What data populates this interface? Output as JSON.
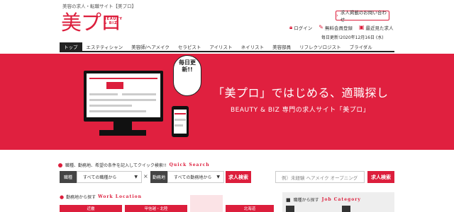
{
  "header": {
    "tagline": "美容の求人・転職サイト【美プロ】",
    "logo_kanji": "美プロ",
    "logo_sub_1": "BEAUTY",
    "logo_sub_2": "& BIZ",
    "inquiry": "求人掲載のお問い合わせ",
    "links": [
      {
        "label": "ログイン",
        "icon": "lock-icon"
      },
      {
        "label": "無料会員登録",
        "icon": "register-icon"
      },
      {
        "label": "最近見た求人",
        "icon": "history-icon"
      }
    ],
    "updated": "毎日更新!2020年12月16日 (水)"
  },
  "nav": [
    "トップ",
    "エステティシャン",
    "美容師/ヘアメイク",
    "セラピスト",
    "アイリスト",
    "ネイリスト",
    "美容部員",
    "リフレクソロジスト",
    "ブライダル"
  ],
  "hero": {
    "bubble": "毎日更新!!",
    "title": "「美プロ」ではじめる、適職探し",
    "subtitle": "BEAUTY & BIZ 専門の求人サイト「美プロ」",
    "color": "#e0203f"
  },
  "quick": {
    "label": "職種、勤務地、希望の条件を記入してクイック検索!!",
    "label_en": "Quick Search",
    "occupation_label": "職種",
    "occupation_value": "すべての職種から",
    "times": "×",
    "location_label": "勤務地",
    "location_value": "すべての勤務地から",
    "search_button": "求人検索",
    "keyword_placeholder": "例）未経験 ヘアメイク オープニング",
    "search_button_2": "求人検索"
  },
  "location_section": {
    "label": "勤務地から探す",
    "label_en": "Work Location",
    "regions": [
      "近畿",
      "甲信越・北陸",
      "北海道"
    ]
  },
  "job_section": {
    "label": "職種から探す",
    "label_en": "Job Category"
  }
}
